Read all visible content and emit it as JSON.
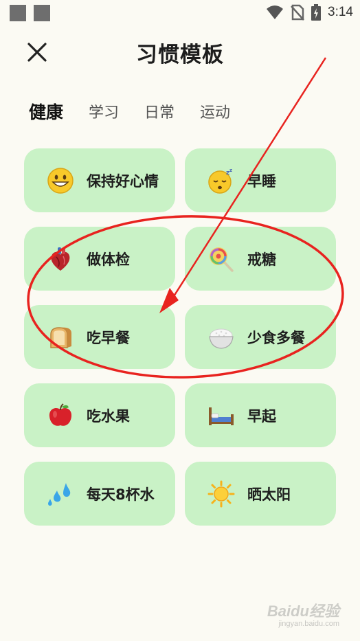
{
  "status_bar": {
    "time": "3:14"
  },
  "header": {
    "title": "习惯模板",
    "close_icon": "close-icon"
  },
  "tabs": [
    {
      "label": "健康",
      "active": true
    },
    {
      "label": "学习",
      "active": false
    },
    {
      "label": "日常",
      "active": false
    },
    {
      "label": "运动",
      "active": false
    }
  ],
  "habits": [
    {
      "label": "保持好心情",
      "icon": "smiley-face-icon",
      "color": "#c9f2c6"
    },
    {
      "label": "早睡",
      "icon": "sleeping-face-icon",
      "color": "#c9f2c6"
    },
    {
      "label": "做体检",
      "icon": "anatomical-heart-icon",
      "color": "#c9f2c6"
    },
    {
      "label": "戒糖",
      "icon": "lollipop-icon",
      "color": "#c9f2c6"
    },
    {
      "label": "吃早餐",
      "icon": "bread-icon",
      "color": "#c9f2c6"
    },
    {
      "label": "少食多餐",
      "icon": "rice-bowl-icon",
      "color": "#c9f2c6"
    },
    {
      "label": "吃水果",
      "icon": "apple-icon",
      "color": "#c9f2c6"
    },
    {
      "label": "早起",
      "icon": "bed-icon",
      "color": "#c9f2c6"
    },
    {
      "label": "每天8杯水",
      "icon": "water-droplets-icon",
      "color": "#c9f2c6"
    },
    {
      "label": "晒太阳",
      "icon": "sun-icon",
      "color": "#c9f2c6"
    }
  ],
  "colors": {
    "background": "#fbfaf3",
    "card": "#c9f2c6",
    "annotation_red": "#e8231f"
  },
  "watermark": {
    "brand": "Baidu经验",
    "url": "jingyan.baidu.com"
  }
}
